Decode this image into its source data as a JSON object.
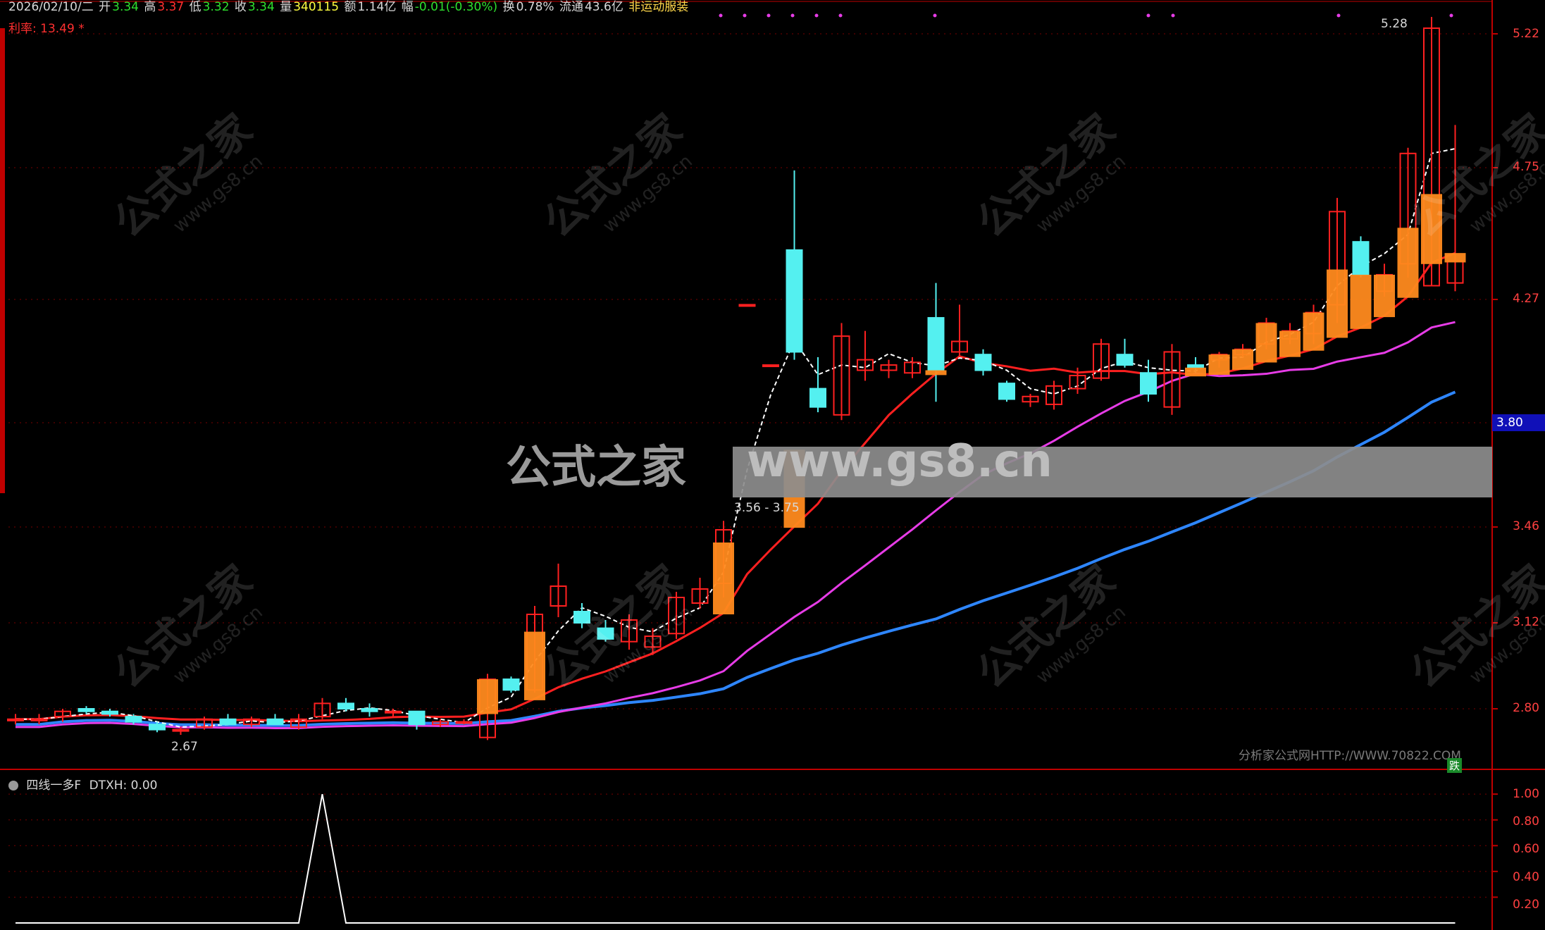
{
  "header": {
    "date": "2026/02/10/二",
    "open_label": "开",
    "open": "3.34",
    "high_label": "高",
    "high": "3.37",
    "low_label": "低",
    "low": "3.32",
    "close_label": "收",
    "close": "3.34",
    "volume_label": "量",
    "volume": "340115",
    "amount_label": "额",
    "amount": "1.14亿",
    "change_label": "幅",
    "change": "-0.01(-0.30%)",
    "turnover_label": "换",
    "turnover": "0.78%",
    "float_label": "流通",
    "float": "43.6亿",
    "sector": "非运动服装"
  },
  "sub_header": "利率: 13.49 *",
  "price_axis": [
    "5.22",
    "4.75",
    "4.27",
    "3.80",
    "3.46",
    "3.12",
    "2.80"
  ],
  "current_price_tag": "3.80",
  "annotations": {
    "high_mark": "5.28",
    "low_mark": "2.67",
    "range_label": "3.56 - 3.75",
    "copyright": "分析家公式网HTTP://WWW.70822.COM",
    "down_badge": "跌"
  },
  "watermark": {
    "main": "公式之家",
    "url": "www.gs8.cn"
  },
  "indicator": {
    "title": "四线一多F",
    "value_label": "DTXH: 0.00",
    "axis": [
      "1.00",
      "0.80",
      "0.60",
      "0.40",
      "0.20"
    ]
  },
  "colors": {
    "up": "#ff2020",
    "down": "#54f0f0",
    "orange": "#ff8a1e",
    "magenta": "#e73ce7",
    "blue": "#2e86ff",
    "white": "#ffffff",
    "grid": "#7a0000",
    "axis": "#c00000"
  },
  "chart_data": {
    "type": "candlestick",
    "price_axis_ticks": [
      5.22,
      4.75,
      4.27,
      3.8,
      3.46,
      3.12,
      2.8
    ],
    "candles": [
      {
        "o": 2.76,
        "h": 2.78,
        "l": 2.74,
        "c": 2.76
      },
      {
        "o": 2.76,
        "h": 2.78,
        "l": 2.74,
        "c": 2.76
      },
      {
        "o": 2.77,
        "h": 2.8,
        "l": 2.75,
        "c": 2.79
      },
      {
        "o": 2.8,
        "h": 2.81,
        "l": 2.78,
        "c": 2.79
      },
      {
        "o": 2.79,
        "h": 2.8,
        "l": 2.77,
        "c": 2.78
      },
      {
        "o": 2.77,
        "h": 2.78,
        "l": 2.74,
        "c": 2.75
      },
      {
        "o": 2.74,
        "h": 2.75,
        "l": 2.71,
        "c": 2.72
      },
      {
        "o": 2.72,
        "h": 2.73,
        "l": 2.7,
        "c": 2.72
      },
      {
        "o": 2.73,
        "h": 2.77,
        "l": 2.72,
        "c": 2.76
      },
      {
        "o": 2.76,
        "h": 2.78,
        "l": 2.74,
        "c": 2.74
      },
      {
        "o": 2.74,
        "h": 2.77,
        "l": 2.73,
        "c": 2.76
      },
      {
        "o": 2.76,
        "h": 2.78,
        "l": 2.74,
        "c": 2.74
      },
      {
        "o": 2.73,
        "h": 2.78,
        "l": 2.72,
        "c": 2.76
      },
      {
        "o": 2.77,
        "h": 2.84,
        "l": 2.76,
        "c": 2.82
      },
      {
        "o": 2.82,
        "h": 2.84,
        "l": 2.79,
        "c": 2.8
      },
      {
        "o": 2.8,
        "h": 2.82,
        "l": 2.77,
        "c": 2.79
      },
      {
        "o": 2.79,
        "h": 2.8,
        "l": 2.77,
        "c": 2.79
      },
      {
        "o": 2.79,
        "h": 2.79,
        "l": 2.72,
        "c": 2.74
      },
      {
        "o": 2.74,
        "h": 2.76,
        "l": 2.73,
        "c": 2.75
      },
      {
        "o": 2.75,
        "h": 2.76,
        "l": 2.74,
        "c": 2.75
      },
      {
        "o": 2.69,
        "h": 2.93,
        "l": 2.68,
        "c": 2.91
      },
      {
        "o": 2.91,
        "h": 2.92,
        "l": 2.86,
        "c": 2.87
      },
      {
        "o": 2.87,
        "h": 3.18,
        "l": 2.86,
        "c": 3.15
      },
      {
        "o": 3.18,
        "h": 3.33,
        "l": 3.14,
        "c": 3.25
      },
      {
        "o": 3.16,
        "h": 3.19,
        "l": 3.1,
        "c": 3.12
      },
      {
        "o": 3.1,
        "h": 3.13,
        "l": 3.05,
        "c": 3.06
      },
      {
        "o": 3.05,
        "h": 3.15,
        "l": 3.02,
        "c": 3.13
      },
      {
        "o": 3.03,
        "h": 3.1,
        "l": 3.0,
        "c": 3.07
      },
      {
        "o": 3.08,
        "h": 3.23,
        "l": 3.06,
        "c": 3.21
      },
      {
        "o": 3.19,
        "h": 3.28,
        "l": 3.17,
        "c": 3.24
      },
      {
        "o": 3.26,
        "h": 3.48,
        "l": 3.21,
        "c": 3.45
      },
      {
        "o": 4.25,
        "h": 4.25,
        "l": 4.25,
        "c": 4.25
      },
      {
        "o": 4.02,
        "h": 4.02,
        "l": 4.02,
        "c": 4.02
      },
      {
        "o": 4.45,
        "h": 4.74,
        "l": 4.04,
        "c": 4.07
      },
      {
        "o": 3.93,
        "h": 4.05,
        "l": 3.84,
        "c": 3.86
      },
      {
        "o": 3.83,
        "h": 4.18,
        "l": 3.81,
        "c": 4.13
      },
      {
        "o": 4.0,
        "h": 4.15,
        "l": 3.96,
        "c": 4.04
      },
      {
        "o": 4.0,
        "h": 4.04,
        "l": 3.97,
        "c": 4.02
      },
      {
        "o": 3.99,
        "h": 4.05,
        "l": 3.97,
        "c": 4.03
      },
      {
        "o": 4.2,
        "h": 4.33,
        "l": 3.88,
        "c": 4.0
      },
      {
        "o": 4.07,
        "h": 4.25,
        "l": 4.05,
        "c": 4.11
      },
      {
        "o": 4.06,
        "h": 4.08,
        "l": 3.98,
        "c": 4.0
      },
      {
        "o": 3.95,
        "h": 3.96,
        "l": 3.88,
        "c": 3.89
      },
      {
        "o": 3.88,
        "h": 3.91,
        "l": 3.86,
        "c": 3.9
      },
      {
        "o": 3.87,
        "h": 3.96,
        "l": 3.85,
        "c": 3.94
      },
      {
        "o": 3.93,
        "h": 4.01,
        "l": 3.91,
        "c": 3.98
      },
      {
        "o": 3.97,
        "h": 4.12,
        "l": 3.96,
        "c": 4.1
      },
      {
        "o": 4.06,
        "h": 4.12,
        "l": 4.01,
        "c": 4.02
      },
      {
        "o": 3.99,
        "h": 4.04,
        "l": 3.88,
        "c": 3.91
      },
      {
        "o": 3.86,
        "h": 4.1,
        "l": 3.83,
        "c": 4.07
      },
      {
        "o": 4.02,
        "h": 4.05,
        "l": 3.99,
        "c": 4.01
      },
      {
        "o": 4.04,
        "h": 4.07,
        "l": 4.01,
        "c": 4.06
      },
      {
        "o": 4.06,
        "h": 4.1,
        "l": 4.05,
        "c": 4.08
      },
      {
        "o": 4.1,
        "h": 4.2,
        "l": 4.08,
        "c": 4.18
      },
      {
        "o": 4.12,
        "h": 4.18,
        "l": 4.1,
        "c": 4.15
      },
      {
        "o": 4.14,
        "h": 4.25,
        "l": 4.1,
        "c": 4.22
      },
      {
        "o": 4.25,
        "h": 4.64,
        "l": 4.18,
        "c": 4.59
      },
      {
        "o": 4.48,
        "h": 4.5,
        "l": 4.35,
        "c": 4.36
      },
      {
        "o": 4.3,
        "h": 4.4,
        "l": 4.28,
        "c": 4.36
      },
      {
        "o": 4.4,
        "h": 4.82,
        "l": 4.35,
        "c": 4.8
      },
      {
        "o": 4.32,
        "h": 5.28,
        "l": 4.32,
        "c": 5.24
      },
      {
        "o": 4.33,
        "h": 4.9,
        "l": 4.3,
        "c": 4.41
      }
    ],
    "indicator_series": {
      "name": "DTXH",
      "values": [
        0,
        0,
        0,
        0,
        0,
        0,
        0,
        0,
        0,
        0,
        0,
        0,
        0,
        1,
        0,
        0,
        0,
        0,
        0,
        0,
        0,
        0,
        0,
        0,
        0,
        0,
        0,
        0,
        0,
        0,
        0,
        0,
        0,
        0,
        0,
        0,
        0,
        0,
        0,
        0,
        0,
        0,
        0,
        0,
        0,
        0,
        0,
        0,
        0,
        0,
        0,
        0,
        0,
        0,
        0,
        0,
        0,
        0,
        0,
        0,
        0,
        0
      ]
    },
    "ylim": [
      2.6,
      5.3
    ],
    "indicator_ylim": [
      0,
      1.05
    ]
  }
}
